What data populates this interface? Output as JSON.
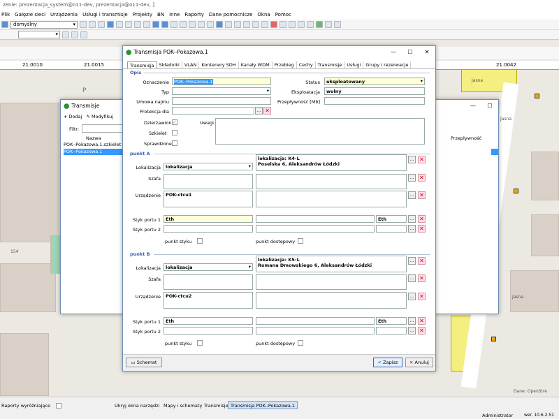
{
  "app_title": "zenie: prezentacja_system@o11-dev, prezentacja@o11-dev, ]",
  "menu": [
    "Plik",
    "Gałęzie sieci",
    "Urządzenia",
    "Usługi i transmisje",
    "Projekty",
    "BN",
    "Inne",
    "Raporty",
    "Dane pomocnicze",
    "Okna",
    "Pomoc"
  ],
  "toolbar": {
    "style_combo": "domyślny"
  },
  "ruler": {
    "labels": [
      "21.0010",
      "21.0015",
      "21.0042"
    ]
  },
  "map": {
    "labels": [
      "P",
      "P",
      "P",
      "Jasna",
      "Jasna",
      "Jasna",
      "154"
    ],
    "attribution": "Dane: OpenStre"
  },
  "list_window": {
    "title": "Transmisje",
    "add_label": "Dodaj",
    "modify_label": "Modyfikuj",
    "filter_label": "Filtr:",
    "col_name": "Nazwa",
    "col_throughput": "Przepływność",
    "rows": [
      "POK--Pokazowa.1.szkielet",
      "POK--Pokazowa.1"
    ]
  },
  "dialog": {
    "title": "Transmisja POK--Pokazowa.1",
    "tabs": [
      "Transmisja",
      "Składniki",
      "VLAN",
      "Kontenery SDH",
      "Kanały WDM",
      "Przebieg",
      "Cechy",
      "Transmisje",
      "Usługi",
      "Grupy i rezerwacje"
    ],
    "opis": "Opis",
    "oznaczenie_label": "Oznaczenie",
    "oznaczenie": "POK--Pokazowa.1",
    "typ_label": "Typ",
    "umowa_label": "Umowa najmu",
    "protekcja_label": "Protekcja dla",
    "status_label": "Status",
    "status": "eksploatowany",
    "eksploatacja_label": "Eksploatacja",
    "eksploatacja": "wolny",
    "przeplywnosc_label": "Przepływność [Mb]",
    "dzierzawiona_label": "Dzierżawiona",
    "szkielet_label": "Szkielet",
    "sprawdzone_label": "Sprawdzone",
    "uwagi_label": "Uwagi",
    "punkt_a": {
      "title": "punkt A",
      "lokalizacja_label": "Lokalizacja",
      "lokalizacja_combo": "lokalizacja",
      "lok_line1": "lokalizacja: K4-L",
      "lok_line2": "Poselska 6, Aleksandrów Łódzki",
      "szafa_label": "Szafa",
      "urzadzenie_label": "Urządzenie",
      "urzadzenie": "POK-ctcu1",
      "styk1_label": "Styk portu 1",
      "styk1": "Eth",
      "styk1_b": "Eth",
      "styk2_label": "Styk portu 2",
      "punkt_styku": "punkt styku",
      "punkt_dostepowy": "punkt dostępowy"
    },
    "punkt_b": {
      "title": "punkt B",
      "lokalizacja_label": "Lokalizacja",
      "lokalizacja_combo": "lokalizacja",
      "lok_line1": "lokalizacja: K5-L",
      "lok_line2": "Romana Dmowskiego 6, Aleksandrów Łódzki",
      "szafa_label": "Szafa",
      "urzadzenie_label": "Urządzenie",
      "urzadzenie": "POK-ctcu2",
      "styk1_label": "Styk portu 1",
      "styk1": "Eth",
      "styk1_b": "Eth",
      "styk2_label": "Styk portu 2",
      "punkt_styku": "punkt styku",
      "punkt_dostepowy": "punkt dostępowy"
    },
    "schemat_label": "Schemat",
    "zapisz_label": "Zapisz",
    "anuluj_label": "Anuluj"
  },
  "statusbar": {
    "raporty": "Raporty wyróżniające",
    "ukryj": "Ukryj okna narzędzi",
    "tabs": [
      "Mapy i schematy",
      "Transmisje",
      "Transmisja POK--Pokazowa.1"
    ],
    "user": "Administrator",
    "version": "wer. 10.6.2.51"
  },
  "colors": {
    "accent": "#3a64b0",
    "selection": "#3399ff",
    "field_yellow": "#ffffd8"
  }
}
